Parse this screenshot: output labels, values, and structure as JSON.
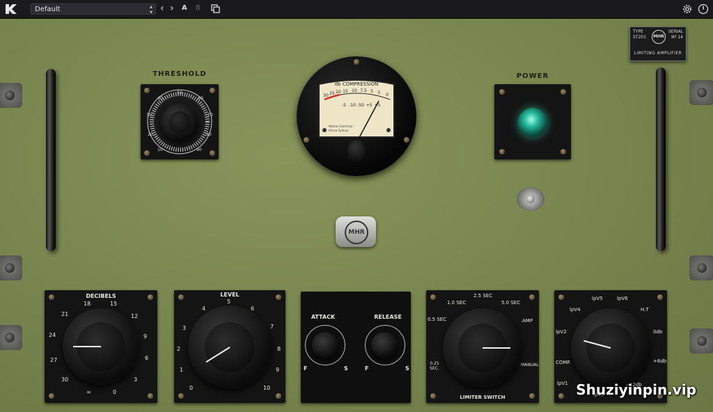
{
  "toolbar": {
    "preset": "Default",
    "ab_a": "A",
    "ab_b": "B",
    "icons": [
      "kush-logo-icon",
      "chevron-left-icon",
      "chevron-right-icon",
      "copy-icon",
      "gear-icon",
      "power-icon"
    ]
  },
  "panel": {
    "threshold_label": "THRESHOLD",
    "threshold_scale": [
      "10",
      "20",
      "30",
      "40",
      "50",
      "60",
      "70",
      "80",
      "90",
      "0"
    ],
    "power_label": "POWER",
    "meter": {
      "title": "db COMPRESSION",
      "scale_top": [
        "30",
        "25",
        "20",
        "15",
        "10",
        "7.5",
        "5",
        "3",
        "0"
      ],
      "scale_bottom": [
        "-5",
        "-10",
        "-50",
        "+5",
        "+5"
      ],
      "maker_line1": "Weston Electrical",
      "maker_line2": "Ithaca Sydney"
    },
    "nameplate": {
      "type_label": "TYPE",
      "type_value": "ST201",
      "serial_label": "SERIAL",
      "serial_value": "Nº 14",
      "product": "LIMITING AMPLIFIER",
      "logo": "MHR"
    },
    "center_badge": "MHR",
    "knobs": {
      "decibels": {
        "label": "DECIBELS",
        "scale": [
          "21",
          "18",
          "15",
          "12",
          "9",
          "6",
          "3",
          "0",
          "∞",
          "30",
          "27",
          "24"
        ]
      },
      "level": {
        "label": "LEVEL",
        "scale": [
          "0",
          "1",
          "2",
          "3",
          "4",
          "5",
          "6",
          "7",
          "8",
          "9",
          "10"
        ]
      },
      "attack": {
        "label": "ATTACK",
        "fast": "F",
        "slow": "S"
      },
      "release": {
        "label": "RELEASE",
        "fast": "F",
        "slow": "S"
      },
      "limiter": {
        "label": "LIMITER SWITCH",
        "scale": [
          "0.5 SEC",
          "1.0 SEC",
          "2.5 SEC",
          "5.0 SEC",
          "AMP",
          "MANUAL",
          "0.25 SEC."
        ]
      },
      "comp": {
        "scale": [
          "lpV2",
          "lpV3",
          "lpV4",
          "lpV5",
          "lpV6",
          "H.T",
          "0db",
          "+6db",
          "+12db",
          "lpV1",
          "COMP."
        ]
      }
    }
  },
  "watermark": "Shuziyinpin.vip"
}
